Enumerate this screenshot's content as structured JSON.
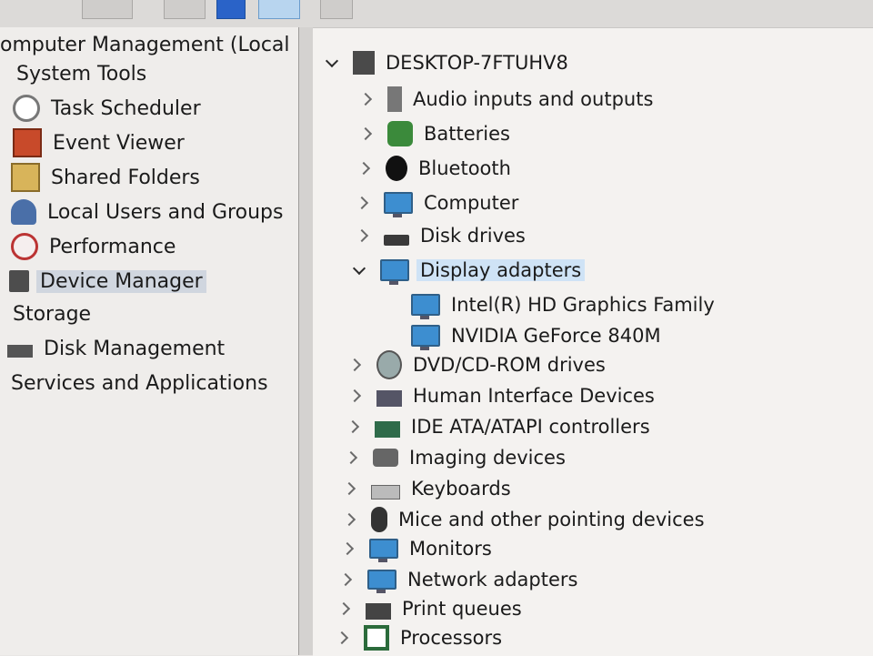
{
  "left_tree": {
    "root": "omputer Management (Local",
    "items": [
      {
        "label": "System Tools",
        "icon": "system-tools-icon"
      },
      {
        "label": "Task Scheduler",
        "icon": "clock-icon"
      },
      {
        "label": "Event Viewer",
        "icon": "event-log-icon"
      },
      {
        "label": "Shared Folders",
        "icon": "shared-folder-icon"
      },
      {
        "label": "Local Users and Groups",
        "icon": "users-icon"
      },
      {
        "label": "Performance",
        "icon": "performance-icon"
      },
      {
        "label": "Device Manager",
        "icon": "device-manager-icon"
      },
      {
        "label": "Storage",
        "icon": ""
      },
      {
        "label": "Disk Management",
        "icon": "disk-icon"
      },
      {
        "label": "Services and Applications",
        "icon": ""
      }
    ],
    "selected": "Device Manager"
  },
  "device_tree": {
    "computer_name": "DESKTOP-7FTUHV8",
    "categories": [
      {
        "label": "Audio inputs and outputs",
        "icon": "speaker-icon"
      },
      {
        "label": "Batteries",
        "icon": "battery-icon"
      },
      {
        "label": "Bluetooth",
        "icon": "bluetooth-icon"
      },
      {
        "label": "Computer",
        "icon": "monitor-icon"
      },
      {
        "label": "Disk drives",
        "icon": "disk-drive-icon"
      },
      {
        "label": "Display adapters",
        "icon": "display-adapter-icon",
        "children": [
          "Intel(R) HD Graphics Family",
          "NVIDIA GeForce 840M"
        ]
      },
      {
        "label": "DVD/CD-ROM drives",
        "icon": "dvd-icon"
      },
      {
        "label": "Human Interface Devices",
        "icon": "hid-icon"
      },
      {
        "label": "IDE ATA/ATAPI controllers",
        "icon": "ide-controller-icon"
      },
      {
        "label": "Imaging devices",
        "icon": "camera-icon"
      },
      {
        "label": "Keyboards",
        "icon": "keyboard-icon"
      },
      {
        "label": "Mice and other pointing devices",
        "icon": "mouse-icon"
      },
      {
        "label": "Monitors",
        "icon": "monitor-icon"
      },
      {
        "label": "Network adapters",
        "icon": "network-icon"
      },
      {
        "label": "Print queues",
        "icon": "printer-icon"
      },
      {
        "label": "Processors",
        "icon": "processor-icon"
      }
    ]
  },
  "colors": {
    "selection": "#d0d6df",
    "highlight": "#cfe3f6",
    "monitor_blue": "#3d8ed0"
  }
}
